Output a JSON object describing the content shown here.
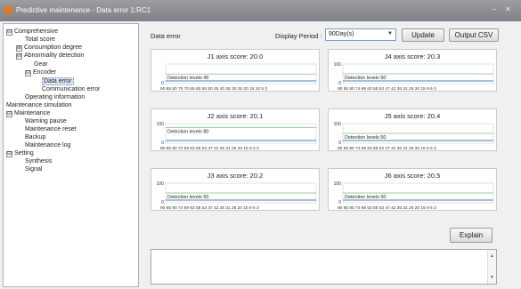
{
  "window": {
    "title": "Predictive maintenance - Data error 1:RC1",
    "min_glyph": "–",
    "close_glyph": "✕"
  },
  "tree": [
    {
      "label": "Comprehensive",
      "level": 0,
      "toggle": "⊟"
    },
    {
      "label": "Total score",
      "level": 2
    },
    {
      "label": "Consumption degree",
      "level": 1,
      "toggle": "⊞"
    },
    {
      "label": "Abnormality detection",
      "level": 1,
      "toggle": "⊟"
    },
    {
      "label": "Gear",
      "level": 3
    },
    {
      "label": "Encoder",
      "level": 2,
      "toggle": "⊟"
    },
    {
      "label": "Data error",
      "level": 4,
      "selected": true
    },
    {
      "label": "Communication error",
      "level": 4
    },
    {
      "label": "Operating information",
      "level": 2
    },
    {
      "label": "Maintenance simulation",
      "level": 0
    },
    {
      "label": "Maintenance",
      "level": 0,
      "toggle": "⊟"
    },
    {
      "label": "Warning pause",
      "level": 2
    },
    {
      "label": "Maintenance reset",
      "level": 2
    },
    {
      "label": "Backup",
      "level": 2
    },
    {
      "label": "Maintenance log",
      "level": 2
    },
    {
      "label": "Setting",
      "level": 0,
      "toggle": "⊟"
    },
    {
      "label": "Synthesis",
      "level": 2
    },
    {
      "label": "Signal",
      "level": 2
    }
  ],
  "header": {
    "section_label": "Data error",
    "period_label": "Display Period :",
    "period_value": "90Day(s)",
    "update_label": "Update",
    "output_csv_label": "Output CSV"
  },
  "explain_label": "Explain",
  "log_text": "",
  "colors": {
    "detection_line": "#7ec27e",
    "series_line": "#4a7fb5",
    "combo_border": "#7a9cd3"
  },
  "panels": [
    {
      "title": "J1 axis score: 20.0",
      "detection": "Detection levels 49",
      "y_max": "",
      "y_min": "0",
      "x_ticks": "90 85 80 75 70 65 60 55 50 45 40 35 30 25 20 15 10 5 3",
      "detection_level": 49
    },
    {
      "title": "J4 axis score: 20.3",
      "detection": "Detection levels 50",
      "y_max": "100",
      "y_min": "0",
      "x_ticks": "90 85 80 74 69 63 58 53 47 42 36 31 26 20 15 9 6 3",
      "detection_level": 50
    },
    {
      "title": "J2 axis score: 20.1",
      "detection": "Detection levels 80",
      "y_max": "100",
      "y_min": "0",
      "x_ticks": "90 85 80 74 69 63 58 53 47 42 36 31 26 20 15 9 6 3",
      "detection_level": 80
    },
    {
      "title": "J5 axis score: 20.4",
      "detection": "Detection levels 50",
      "y_max": "100",
      "y_min": "0",
      "x_ticks": "90 85 80 74 69 63 58 53 47 42 36 31 26 20 15 9 6 3",
      "detection_level": 50
    },
    {
      "title": "J3 axis score: 20.2",
      "detection": "Detection levels 50",
      "y_max": "100",
      "y_min": "0",
      "x_ticks": "90 85 80 74 69 63 58 53 47 42 36 31 26 20 15 9 6 3",
      "detection_level": 50
    },
    {
      "title": "J6 axis score: 20.5",
      "detection": "Detection levels 50",
      "y_max": "100",
      "y_min": "0",
      "x_ticks": "90 85 80 74 69 63 58 53 47 42 36 31 26 20 15 9 6 3",
      "detection_level": 50
    }
  ]
}
